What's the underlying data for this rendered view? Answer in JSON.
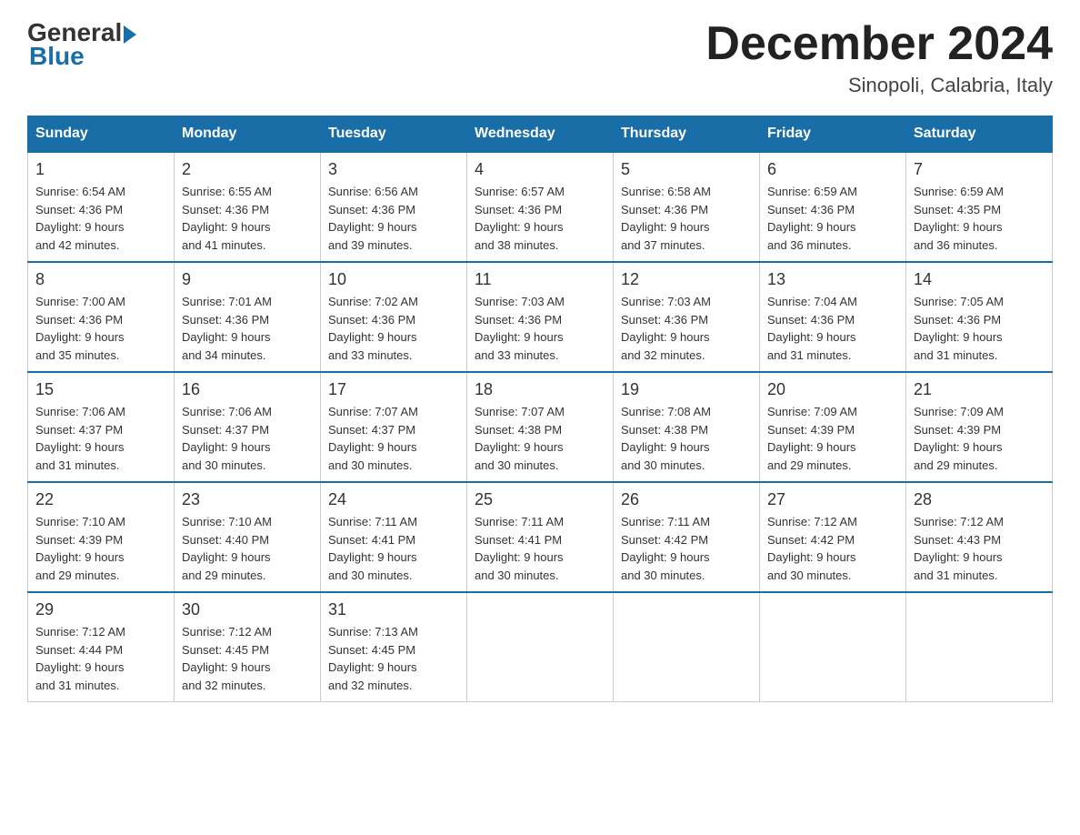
{
  "logo": {
    "general": "General",
    "blue": "Blue"
  },
  "title": "December 2024",
  "subtitle": "Sinopoli, Calabria, Italy",
  "days_of_week": [
    "Sunday",
    "Monday",
    "Tuesday",
    "Wednesday",
    "Thursday",
    "Friday",
    "Saturday"
  ],
  "weeks": [
    [
      {
        "day": "1",
        "sunrise": "6:54 AM",
        "sunset": "4:36 PM",
        "daylight": "9 hours and 42 minutes."
      },
      {
        "day": "2",
        "sunrise": "6:55 AM",
        "sunset": "4:36 PM",
        "daylight": "9 hours and 41 minutes."
      },
      {
        "day": "3",
        "sunrise": "6:56 AM",
        "sunset": "4:36 PM",
        "daylight": "9 hours and 39 minutes."
      },
      {
        "day": "4",
        "sunrise": "6:57 AM",
        "sunset": "4:36 PM",
        "daylight": "9 hours and 38 minutes."
      },
      {
        "day": "5",
        "sunrise": "6:58 AM",
        "sunset": "4:36 PM",
        "daylight": "9 hours and 37 minutes."
      },
      {
        "day": "6",
        "sunrise": "6:59 AM",
        "sunset": "4:36 PM",
        "daylight": "9 hours and 36 minutes."
      },
      {
        "day": "7",
        "sunrise": "6:59 AM",
        "sunset": "4:35 PM",
        "daylight": "9 hours and 36 minutes."
      }
    ],
    [
      {
        "day": "8",
        "sunrise": "7:00 AM",
        "sunset": "4:36 PM",
        "daylight": "9 hours and 35 minutes."
      },
      {
        "day": "9",
        "sunrise": "7:01 AM",
        "sunset": "4:36 PM",
        "daylight": "9 hours and 34 minutes."
      },
      {
        "day": "10",
        "sunrise": "7:02 AM",
        "sunset": "4:36 PM",
        "daylight": "9 hours and 33 minutes."
      },
      {
        "day": "11",
        "sunrise": "7:03 AM",
        "sunset": "4:36 PM",
        "daylight": "9 hours and 33 minutes."
      },
      {
        "day": "12",
        "sunrise": "7:03 AM",
        "sunset": "4:36 PM",
        "daylight": "9 hours and 32 minutes."
      },
      {
        "day": "13",
        "sunrise": "7:04 AM",
        "sunset": "4:36 PM",
        "daylight": "9 hours and 31 minutes."
      },
      {
        "day": "14",
        "sunrise": "7:05 AM",
        "sunset": "4:36 PM",
        "daylight": "9 hours and 31 minutes."
      }
    ],
    [
      {
        "day": "15",
        "sunrise": "7:06 AM",
        "sunset": "4:37 PM",
        "daylight": "9 hours and 31 minutes."
      },
      {
        "day": "16",
        "sunrise": "7:06 AM",
        "sunset": "4:37 PM",
        "daylight": "9 hours and 30 minutes."
      },
      {
        "day": "17",
        "sunrise": "7:07 AM",
        "sunset": "4:37 PM",
        "daylight": "9 hours and 30 minutes."
      },
      {
        "day": "18",
        "sunrise": "7:07 AM",
        "sunset": "4:38 PM",
        "daylight": "9 hours and 30 minutes."
      },
      {
        "day": "19",
        "sunrise": "7:08 AM",
        "sunset": "4:38 PM",
        "daylight": "9 hours and 30 minutes."
      },
      {
        "day": "20",
        "sunrise": "7:09 AM",
        "sunset": "4:39 PM",
        "daylight": "9 hours and 29 minutes."
      },
      {
        "day": "21",
        "sunrise": "7:09 AM",
        "sunset": "4:39 PM",
        "daylight": "9 hours and 29 minutes."
      }
    ],
    [
      {
        "day": "22",
        "sunrise": "7:10 AM",
        "sunset": "4:39 PM",
        "daylight": "9 hours and 29 minutes."
      },
      {
        "day": "23",
        "sunrise": "7:10 AM",
        "sunset": "4:40 PM",
        "daylight": "9 hours and 29 minutes."
      },
      {
        "day": "24",
        "sunrise": "7:11 AM",
        "sunset": "4:41 PM",
        "daylight": "9 hours and 30 minutes."
      },
      {
        "day": "25",
        "sunrise": "7:11 AM",
        "sunset": "4:41 PM",
        "daylight": "9 hours and 30 minutes."
      },
      {
        "day": "26",
        "sunrise": "7:11 AM",
        "sunset": "4:42 PM",
        "daylight": "9 hours and 30 minutes."
      },
      {
        "day": "27",
        "sunrise": "7:12 AM",
        "sunset": "4:42 PM",
        "daylight": "9 hours and 30 minutes."
      },
      {
        "day": "28",
        "sunrise": "7:12 AM",
        "sunset": "4:43 PM",
        "daylight": "9 hours and 31 minutes."
      }
    ],
    [
      {
        "day": "29",
        "sunrise": "7:12 AM",
        "sunset": "4:44 PM",
        "daylight": "9 hours and 31 minutes."
      },
      {
        "day": "30",
        "sunrise": "7:12 AM",
        "sunset": "4:45 PM",
        "daylight": "9 hours and 32 minutes."
      },
      {
        "day": "31",
        "sunrise": "7:13 AM",
        "sunset": "4:45 PM",
        "daylight": "9 hours and 32 minutes."
      },
      null,
      null,
      null,
      null
    ]
  ],
  "labels": {
    "sunrise": "Sunrise:",
    "sunset": "Sunset:",
    "daylight": "Daylight:"
  }
}
